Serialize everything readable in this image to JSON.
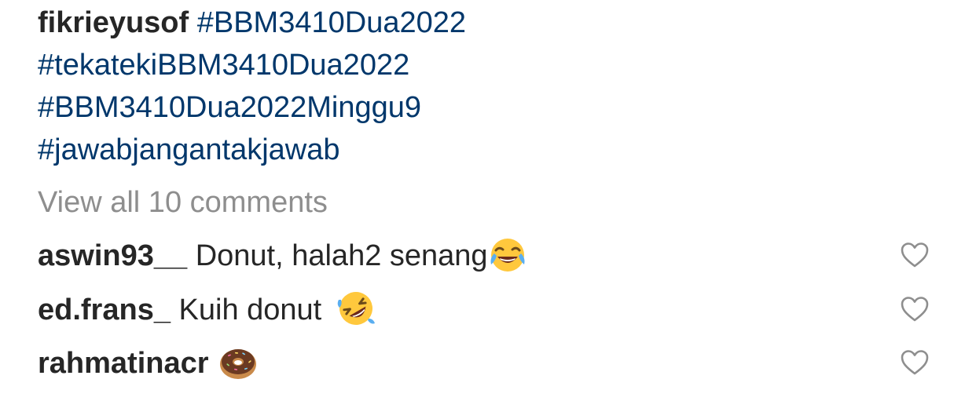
{
  "post": {
    "author": "fikrieyusof",
    "hashtags": [
      "#BBM3410Dua2022",
      "#tekatekiBBM3410Dua2022",
      "#BBM3410Dua2022Minggu9",
      "#jawabjangantakjawab"
    ]
  },
  "view_all_comments": "View all 10 comments",
  "comments": [
    {
      "user": "aswin93__",
      "text": "Donut, halah2 senang",
      "emoji": "face-with-tears-of-joy"
    },
    {
      "user": "ed.frans_",
      "text": "Kuih donut",
      "emoji": "rolling-on-floor-laughing"
    },
    {
      "user": "rahmatinacr",
      "text": "",
      "emoji": "doughnut"
    }
  ],
  "icons": {
    "like": "heart-outline-icon"
  },
  "colors": {
    "text": "#262626",
    "hashtag": "#00376b",
    "muted": "#8e8e8e"
  }
}
